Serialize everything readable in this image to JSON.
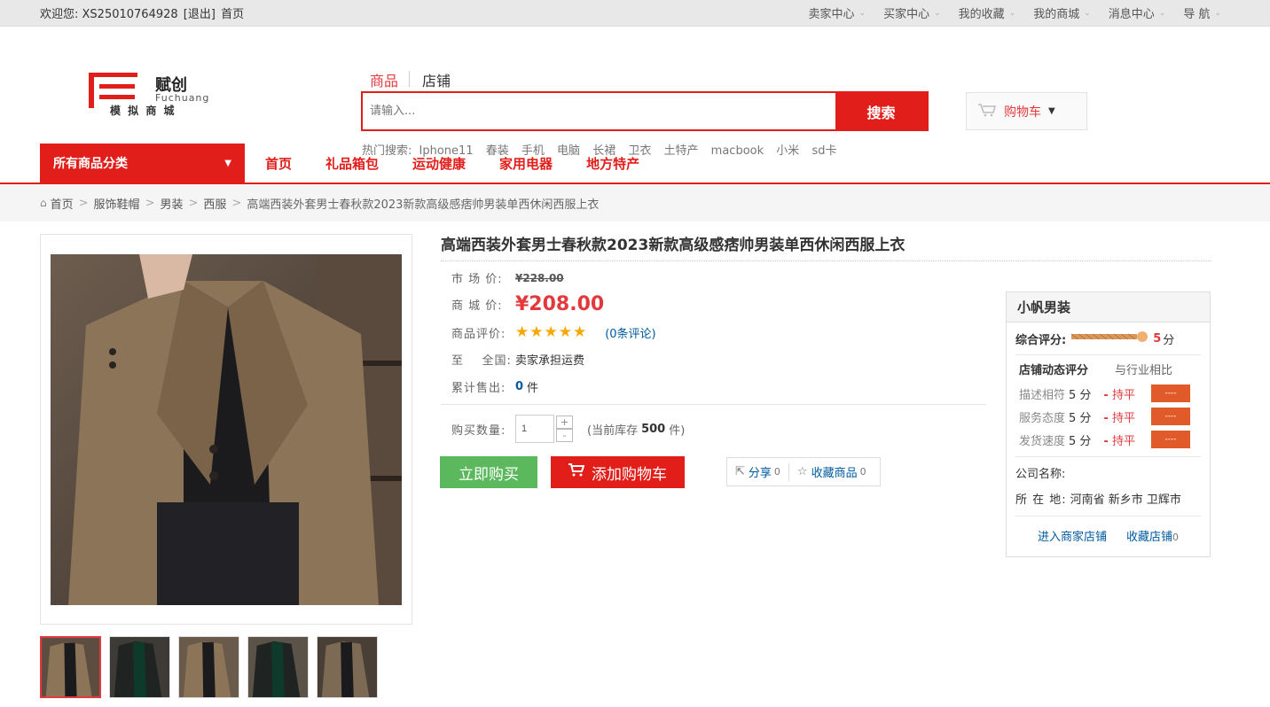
{
  "topbar": {
    "welcome": "欢迎您: XS25010764928",
    "logout": "[退出]",
    "home": "首页",
    "menu": [
      "卖家中心",
      "买家中心",
      "我的收藏",
      "我的商城",
      "消息中心",
      "导 航"
    ]
  },
  "logo": {
    "brand_cn": "赋创",
    "brand_en": "Fuchuang",
    "sub": "模 拟 商 城"
  },
  "search": {
    "tab_goods": "商品",
    "tab_shop": "店铺",
    "placeholder": "请输入...",
    "button": "搜索",
    "hot_label": "热门搜索:",
    "hot": [
      "Iphone11",
      "春装",
      "手机",
      "电脑",
      "长裙",
      "卫衣",
      "土特产",
      "macbook",
      "小米",
      "sd卡"
    ]
  },
  "cart": {
    "label": "购物车"
  },
  "nav": {
    "all_categories": "所有商品分类",
    "links": [
      "首页",
      "礼品箱包",
      "运动健康",
      "家用电器",
      "地方特产"
    ]
  },
  "breadcrumb": [
    "首页",
    "服饰鞋帽",
    "男装",
    "西服",
    "高端西装外套男士春秋款2023新款高级感痞帅男装单西休闲西服上衣"
  ],
  "product": {
    "title": "高端西装外套男士春秋款2023新款高级感痞帅男装单西休闲西服上衣",
    "market_label": "市 场 价:",
    "market_price": "¥228.00",
    "mall_label": "商 城 价:",
    "mall_price": "¥208.00",
    "rating_label": "商品评价:",
    "rating_stars": 5,
    "reviews": "(0条评论)",
    "ship_label": "至    全国:",
    "ship_value": "卖家承担运费",
    "sold_label": "累计售出:",
    "sold_value": "0",
    "sold_unit": "件",
    "qty_label": "购买数量:",
    "qty_value": "1",
    "stock_prefix": "(当前库存",
    "stock_value": "500",
    "stock_suffix": "件)",
    "buy_now": "立即购买",
    "add_cart": "添加购物车",
    "share": "分享",
    "share_count": "0",
    "fav": "收藏商品",
    "fav_count": "0"
  },
  "shop": {
    "name": "小帆男装",
    "overall_label": "综合评分:",
    "overall_score": "5",
    "overall_unit": "分",
    "dyn_title": "店铺动态评分",
    "compare_title": "与行业相比",
    "rows": [
      {
        "label": "描述相符",
        "score": "5 分",
        "trend": "持平",
        "bar": "----"
      },
      {
        "label": "服务态度",
        "score": "5 分",
        "trend": "持平",
        "bar": "----"
      },
      {
        "label": "发货速度",
        "score": "5 分",
        "trend": "持平",
        "bar": "----"
      }
    ],
    "company_label": "公司名称:",
    "location_label": "所 在 地:",
    "location": "河南省 新乡市 卫辉市",
    "enter": "进入商家店铺",
    "fav_shop": "收藏店铺",
    "fav_shop_count": "0"
  },
  "colors": {
    "accent": "#e21e1a",
    "buy": "#5cb85c",
    "link": "#005aa0"
  }
}
